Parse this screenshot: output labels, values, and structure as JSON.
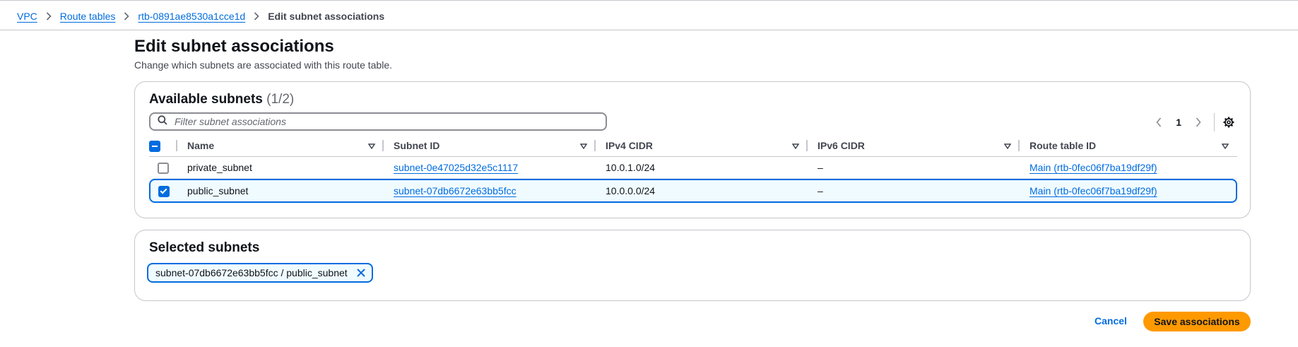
{
  "breadcrumbs": {
    "items": [
      "VPC",
      "Route tables",
      "rtb-0891ae8530a1cce1d"
    ],
    "current": "Edit subnet associations"
  },
  "page": {
    "title": "Edit subnet associations",
    "description": "Change which subnets are associated with this route table."
  },
  "available": {
    "header": "Available subnets",
    "count": "(1/2)",
    "filter_placeholder": "Filter subnet associations",
    "page_number": "1",
    "columns": [
      "Name",
      "Subnet ID",
      "IPv4 CIDR",
      "IPv6 CIDR",
      "Route table ID"
    ],
    "rows": [
      {
        "checked": false,
        "name": "private_subnet",
        "subnet_id": "subnet-0e47025d32e5c1117",
        "ipv4": "10.0.1.0/24",
        "ipv6": "–",
        "route_table": "Main (rtb-0fec06f7ba19df29f)"
      },
      {
        "checked": true,
        "name": "public_subnet",
        "subnet_id": "subnet-07db6672e63bb5fcc",
        "ipv4": "10.0.0.0/24",
        "ipv6": "–",
        "route_table": "Main (rtb-0fec06f7ba19df29f)"
      }
    ]
  },
  "selected": {
    "header": "Selected subnets",
    "tokens": [
      "subnet-07db6672e63bb5fcc / public_subnet"
    ]
  },
  "actions": {
    "cancel": "Cancel",
    "save": "Save associations"
  },
  "colors": {
    "link": "#006ce0",
    "primary_button": "#ff9900",
    "selected_row_bg": "#f0fbff"
  }
}
